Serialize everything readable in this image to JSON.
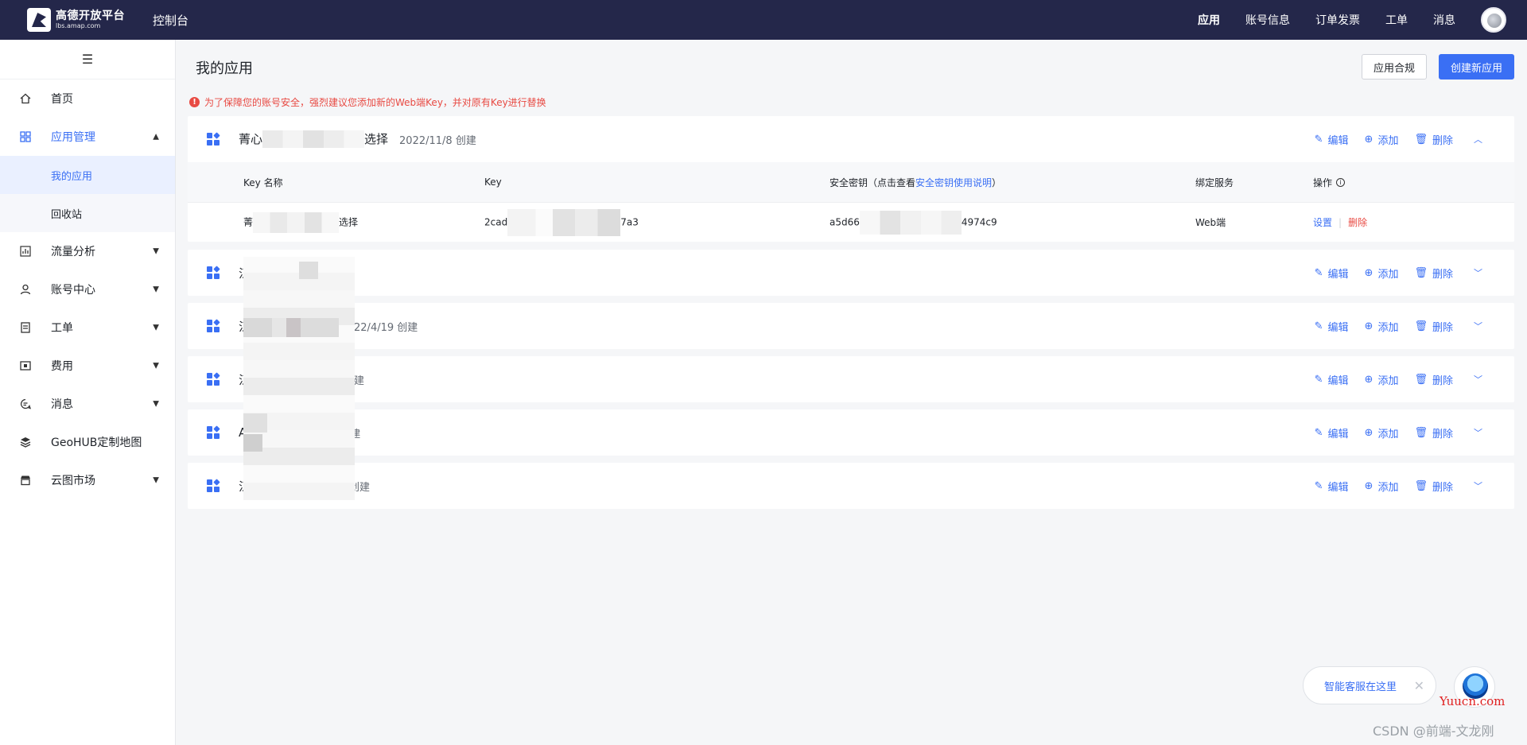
{
  "topbar": {
    "logo_cn": "高德开放平台",
    "logo_en": "lbs.amap.com",
    "console": "控制台",
    "nav": [
      "应用",
      "账号信息",
      "订单发票",
      "工单",
      "消息"
    ]
  },
  "sidebar": {
    "toggle": "☰",
    "items": [
      {
        "label": "首页",
        "icon": "home-icon"
      },
      {
        "label": "应用管理",
        "icon": "grid-icon",
        "expanded": true
      },
      {
        "label": "流量分析",
        "icon": "chart-icon"
      },
      {
        "label": "账号中心",
        "icon": "user-icon"
      },
      {
        "label": "工单",
        "icon": "ticket-icon"
      },
      {
        "label": "费用",
        "icon": "wallet-icon"
      },
      {
        "label": "消息",
        "icon": "message-icon"
      },
      {
        "label": "GeoHUB定制地图",
        "icon": "layers-icon"
      },
      {
        "label": "云图市场",
        "icon": "store-icon"
      }
    ],
    "sub": [
      "我的应用",
      "回收站"
    ]
  },
  "main": {
    "title": "我的应用",
    "btn_compliance": "应用合规",
    "btn_create": "创建新应用",
    "warning": "为了保障您的账号安全，强烈建议您添加新的Web端Key，并对原有Key进行替换",
    "actions": {
      "edit": "编辑",
      "add": "添加",
      "delete": "删除"
    },
    "apps": [
      {
        "name_prefix": "菁心",
        "name_suffix": "选择",
        "date": "2022/11/8 创建",
        "expanded": true
      },
      {
        "name_prefix": "江",
        "name_suffix": "",
        "date": ""
      },
      {
        "name_prefix": "江",
        "name_suffix": "",
        "date": "22/4/19 创建"
      },
      {
        "name_prefix": "江",
        "name_suffix": "",
        "date": "建"
      },
      {
        "name_prefix": "A",
        "name_suffix": "",
        "date": "建"
      },
      {
        "name_prefix": "江",
        "name_suffix": "",
        "date": "创建"
      }
    ],
    "key_table": {
      "headers": {
        "name": "Key 名称",
        "key": "Key",
        "secret_prefix": "安全密钥（点击查看",
        "secret_link": "安全密钥使用说明",
        "secret_suffix": "）",
        "service": "绑定服务",
        "ops": "操作"
      },
      "row": {
        "name_prefix": "菁",
        "name_suffix": "选择",
        "key_prefix": "2cad",
        "key_suffix": "7a3",
        "secret_prefix": "a5d66",
        "secret_suffix": "4974c9",
        "service": "Web端",
        "op_settings": "设置",
        "op_delete": "删除"
      }
    }
  },
  "assistant": {
    "text": "智能客服在这里",
    "close": "✕"
  },
  "watermarks": {
    "site": "Yuucn.com",
    "csdn": "CSDN @前端-文龙刚"
  },
  "colors": {
    "primary": "#3a6ff4",
    "danger": "#e84a43",
    "topbar": "#24274a"
  }
}
